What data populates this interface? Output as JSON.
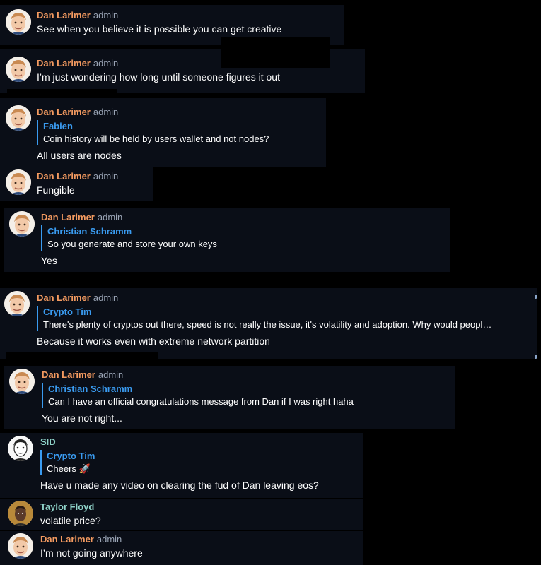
{
  "colors": {
    "admin_name": "#f39a60",
    "user_name": "#8fd3c9",
    "reply_accent": "#3a9bf0",
    "bubble_bg": "#0a0e17",
    "page_bg": "#000000"
  },
  "messages": [
    {
      "author": "Dan Larimer",
      "role": "admin",
      "avatar": "dan-avatar",
      "text": "See when you believe it is possible you can get creative"
    },
    {
      "author": "Dan Larimer",
      "role": "admin",
      "avatar": "dan-avatar",
      "text": "I’m just wondering how long until someone figures it out"
    },
    {
      "author": "Dan Larimer",
      "role": "admin",
      "avatar": "dan-avatar",
      "reply": {
        "author": "Fabien",
        "text": "Coin history will be held by users wallet and not nodes?"
      },
      "text": "All users are nodes"
    },
    {
      "author": "Dan Larimer",
      "role": "admin",
      "avatar": "dan-avatar",
      "text": "Fungible"
    },
    {
      "author": "Dan Larimer",
      "role": "admin",
      "avatar": "dan-avatar",
      "reply": {
        "author": "Christian Schramm",
        "text": "So you generate and store your own keys"
      },
      "text": "Yes"
    },
    {
      "author": "Dan Larimer",
      "role": "admin",
      "avatar": "dan-avatar",
      "reply": {
        "author": "Crypto Tim",
        "text": "There's plenty of cryptos out there, speed is not really the issue, it's volatility and adoption. Why would peopl…"
      },
      "text": "Because it works even with extreme network partition"
    },
    {
      "author": "Dan Larimer",
      "role": "admin",
      "avatar": "dan-avatar",
      "reply": {
        "author": "Christian Schramm",
        "text": "Can I have an official congratulations message from Dan if I was right haha"
      },
      "text": "You are not right..."
    },
    {
      "author": "SID",
      "role": "",
      "avatar": "sid-avatar",
      "reply": {
        "author": "Crypto Tim",
        "text": "Cheers 🚀"
      },
      "text": "Have u made any video on clearing the fud of Dan leaving eos?"
    },
    {
      "author": "Taylor Floyd",
      "role": "",
      "avatar": "taylor-avatar",
      "text": "volatile price?"
    },
    {
      "author": "Dan Larimer",
      "role": "admin",
      "avatar": "dan-avatar",
      "text": "I’m not going anywhere"
    }
  ]
}
